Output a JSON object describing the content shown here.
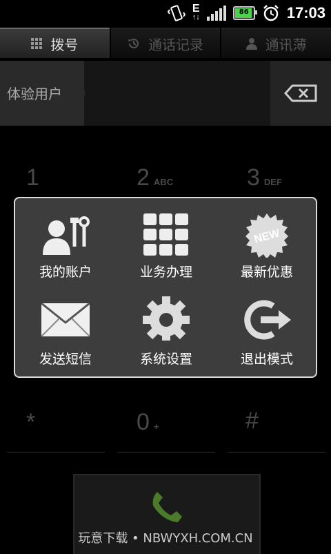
{
  "status": {
    "time": "17:03",
    "battery": "86",
    "network": "E"
  },
  "tabs": [
    {
      "label": "拨号",
      "icon": "grid-icon",
      "active": true
    },
    {
      "label": "通话记录",
      "icon": "history-icon",
      "active": false
    },
    {
      "label": "通讯薄",
      "icon": "person-icon",
      "active": false
    }
  ],
  "input": {
    "text": "体验用户"
  },
  "keypad": {
    "row1": [
      {
        "digit": "1",
        "letters": ""
      },
      {
        "digit": "2",
        "letters": "ABC"
      },
      {
        "digit": "3",
        "letters": "DEF"
      }
    ],
    "row4": [
      {
        "digit": "*",
        "letters": ""
      },
      {
        "digit": "0",
        "letters": "+"
      },
      {
        "digit": "#",
        "letters": ""
      }
    ]
  },
  "menu": {
    "items": [
      {
        "label": "我的账户",
        "icon": "account-tools-icon"
      },
      {
        "label": "业务办理",
        "icon": "grid-icon"
      },
      {
        "label": "最新优惠",
        "icon": "new-badge-icon",
        "badge": "NEW"
      },
      {
        "label": "发送短信",
        "icon": "envelope-icon"
      },
      {
        "label": "系统设置",
        "icon": "gear-icon"
      },
      {
        "label": "退出模式",
        "icon": "exit-icon"
      }
    ]
  },
  "call": {
    "icon": "phone-icon"
  },
  "watermark": "玩意下载 • NBWYXH.COM.CN",
  "colors": {
    "accent_green": "#4a7a2a",
    "menu_bg": "#3d3d3d"
  }
}
